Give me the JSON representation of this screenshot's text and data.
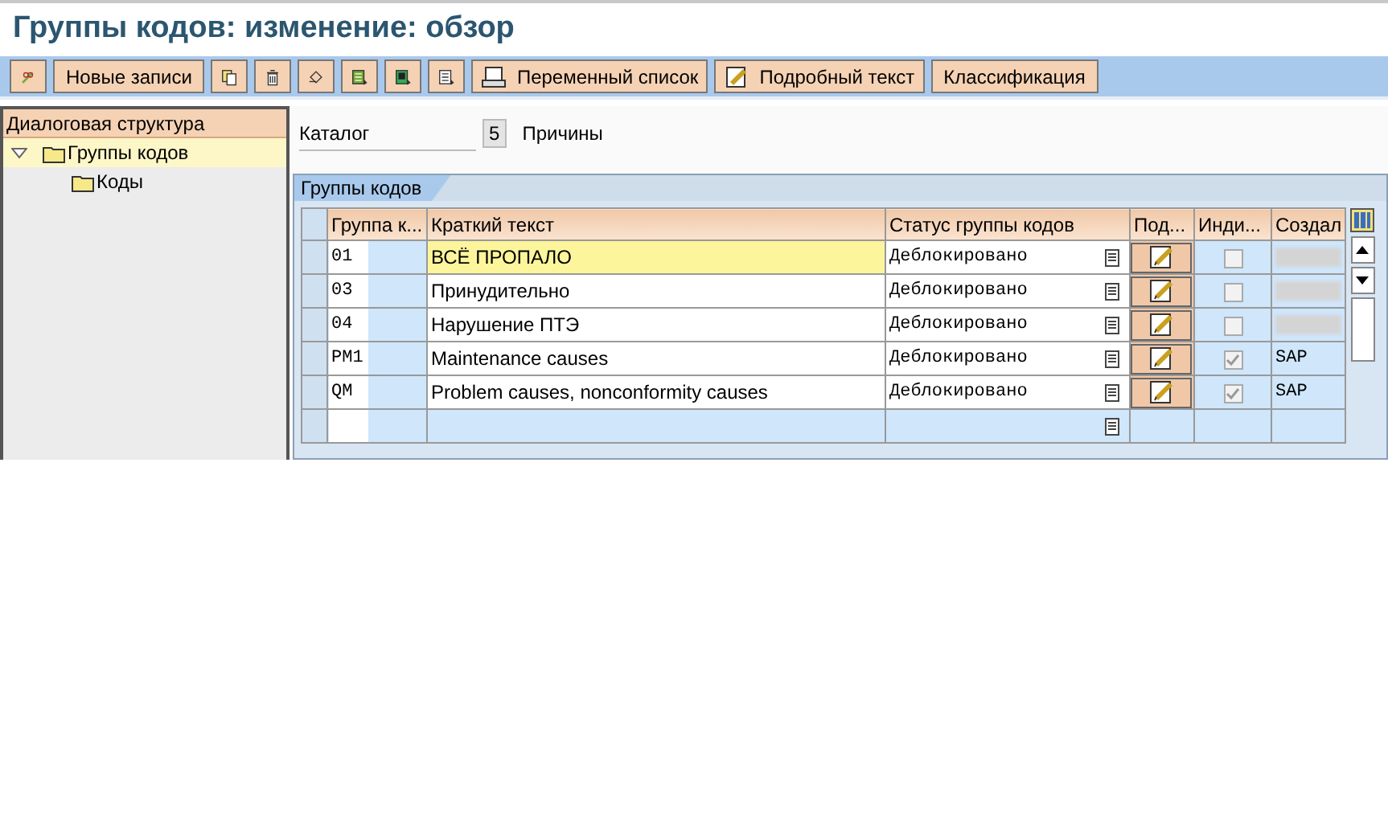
{
  "window": {
    "title": "Группы кодов: изменение: обзор"
  },
  "toolbar": [
    {
      "kind": "icon"
    },
    {
      "kind": "text",
      "label": "Новые записи"
    },
    {
      "kind": "icon"
    },
    {
      "kind": "icon"
    },
    {
      "kind": "icon"
    },
    {
      "kind": "icon"
    },
    {
      "kind": "icon"
    },
    {
      "kind": "icon"
    },
    {
      "kind": "icon_text",
      "label": "Переменный список"
    },
    {
      "kind": "icon_text",
      "label": "Подробный текст"
    },
    {
      "kind": "text",
      "label": "Классификация"
    }
  ],
  "sidebar": {
    "title": "Диалоговая структура",
    "items": [
      {
        "label": "Группы кодов",
        "selected": true,
        "expanded": true,
        "children": [
          {
            "label": "Коды",
            "selected": false
          }
        ]
      }
    ]
  },
  "header": {
    "catalog_label": "Каталог",
    "catalog_value": "5",
    "catalog_text": "Причины"
  },
  "table": {
    "tab": "Группы кодов",
    "columns": [
      "Группа к...",
      "Краткий текст",
      "Статус группы кодов",
      "Под...",
      "Инди...",
      "Создал"
    ],
    "rows": [
      {
        "code": "01",
        "text": "ВСЁ ПРОПАЛО",
        "status": "Деблокировано",
        "checked": false,
        "selected": true
      },
      {
        "code": "03",
        "text": "Принудительно",
        "status": "Деблокировано",
        "checked": false,
        "selected": false
      },
      {
        "code": "04",
        "text": "Нарушение ПТЭ",
        "status": "Деблокировано",
        "checked": false,
        "selected": false
      },
      {
        "code": "PM1",
        "text": "Maintenance causes",
        "status": "Деблокировано",
        "checked": true,
        "selected": false,
        "created_by": "SAP"
      },
      {
        "code": "QM",
        "text": "Problem causes, nonconformity causes",
        "status": "Деблокировано",
        "checked": true,
        "selected": false,
        "created_by": "SAP"
      }
    ]
  }
}
